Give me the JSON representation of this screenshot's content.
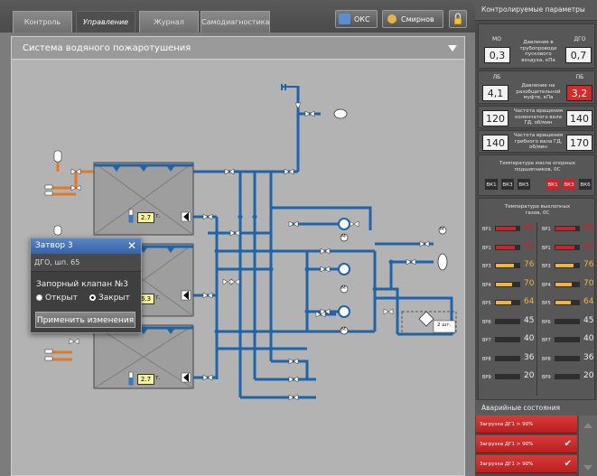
{
  "tabs": [
    {
      "label": "Контроль"
    },
    {
      "label": "Управление"
    },
    {
      "label": "Журнал"
    },
    {
      "label": "Самодиагностика"
    }
  ],
  "header": {
    "oks_label": "ОКС",
    "user_label": "Смирнов Д.П."
  },
  "schema": {
    "title": "Система водяного пожаротушения",
    "tank_levels": [
      "2.7",
      "2.7",
      "6.3",
      "2.7"
    ],
    "tank_unit": "т.",
    "equipment_label": "2 шт.",
    "motor_symbol": "М"
  },
  "dialog": {
    "title": "Затвор 3",
    "close": "✕",
    "subtitle": "ДГО, шп. 65",
    "heading": "Запорный клапан №3",
    "option_open": "Открыт",
    "option_closed": "Закрыт",
    "selected": "Закрыт",
    "apply_label": "Применить изменения"
  },
  "right": {
    "title": "Контролируемые параметры",
    "mo_label": "МО",
    "dgo_label": "ДГО",
    "pressure_label": "Давление в трубопроводе пускового воздуха, кПа",
    "mo_value": "0,3",
    "dgo_value": "0,7",
    "lb_label": "ЛБ",
    "pb_label": "ПБ",
    "coupling_label": "Давление на разобщительной муфте, кПа",
    "lb_value": "4,1",
    "pb_value": "3,2",
    "shaft1_label": "Частота вращения коленчатого вала ГД, об/мин",
    "shaft1_left": "120",
    "shaft1_right": "140",
    "shaft2_label": "Частота вращения гребного вала ГД, об/мин",
    "shaft2_left": "140",
    "shaft2_right": "170",
    "oil_label": "Температура масла опорных подшипников, 0С",
    "vk_left": [
      "ВК1",
      "ВК3",
      "ВК5"
    ],
    "vk_right": [
      "ВК1",
      "ВК3",
      "ВК6"
    ],
    "gas_label": "Температура выхлопных газов, 0С",
    "gas_left": [
      {
        "name": "ВР1",
        "value": "86",
        "level": 0.86,
        "color": "#c8242b"
      },
      {
        "name": "ВР1",
        "value": "80",
        "level": 0.8,
        "color": "#c8242b"
      },
      {
        "name": "ВР3",
        "value": "76",
        "level": 0.76,
        "color": "#f0b43c"
      },
      {
        "name": "ВР4",
        "value": "70",
        "level": 0.7,
        "color": "#f0b43c"
      },
      {
        "name": "ВР5",
        "value": "64",
        "level": 0.64,
        "color": "#f0b43c"
      },
      {
        "name": "ВР6",
        "value": "45",
        "level": 0.0,
        "color": "#2e2e2e"
      },
      {
        "name": "ВР7",
        "value": "40",
        "level": 0.0,
        "color": "#2e2e2e"
      },
      {
        "name": "ВР8",
        "value": "36",
        "level": 0.0,
        "color": "#2e2e2e"
      },
      {
        "name": "ВР9",
        "value": "20",
        "level": 0.0,
        "color": "#2e2e2e"
      }
    ],
    "gas_right": [
      {
        "name": "ВР1",
        "value": "86",
        "level": 0.86,
        "color": "#c8242b"
      },
      {
        "name": "ВР1",
        "value": "80",
        "level": 0.8,
        "color": "#c8242b"
      },
      {
        "name": "ВР3",
        "value": "76",
        "level": 0.76,
        "color": "#f0b43c"
      },
      {
        "name": "ВР4",
        "value": "70",
        "level": 0.7,
        "color": "#f0b43c"
      },
      {
        "name": "ВР5",
        "value": "64",
        "level": 0.64,
        "color": "#f0b43c"
      },
      {
        "name": "ВР6",
        "value": "45",
        "level": 0.0,
        "color": "#2e2e2e"
      },
      {
        "name": "ВР7",
        "value": "40",
        "level": 0.0,
        "color": "#2e2e2e"
      },
      {
        "name": "ВР8",
        "value": "36",
        "level": 0.0,
        "color": "#2e2e2e"
      },
      {
        "name": "ВР9",
        "value": "20",
        "level": 0.0,
        "color": "#2e2e2e"
      }
    ]
  },
  "alarms": {
    "title": "Аварийные состояния",
    "items": [
      {
        "text": "Загрузка ДГ1 > 90%"
      },
      {
        "text": "Загрузка ДГ1 > 90%"
      },
      {
        "text": "Загрузка ДГ1 > 90%"
      }
    ]
  },
  "colors": {
    "pipe": "#1f64a8",
    "pipe_orange": "#e07a2a",
    "red": "#c8242b",
    "yellow": "#f0b43c"
  }
}
